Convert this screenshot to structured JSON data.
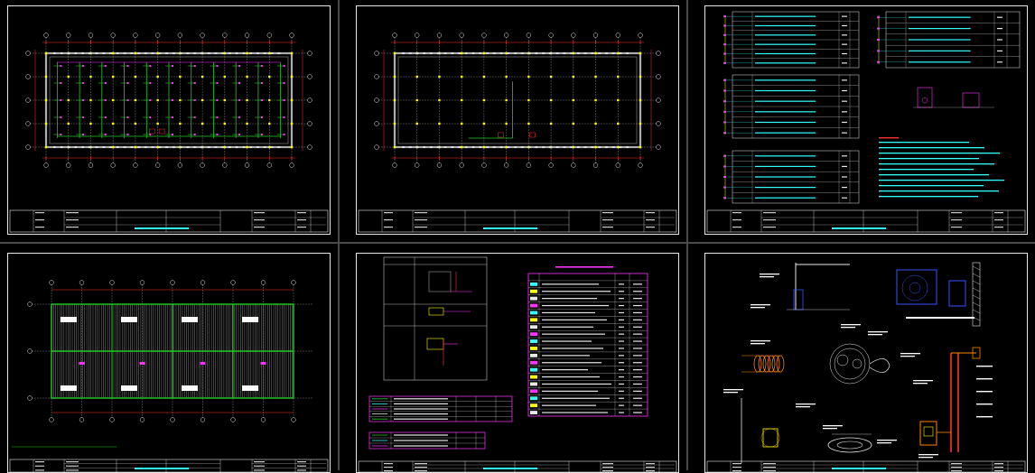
{
  "canvas": {
    "background": "#000000"
  },
  "colors": {
    "frame": "#e8e8e8",
    "axis": "#ff3030",
    "grid": "#9a9a9a",
    "wall": "#b0b0b0",
    "pipe_green": "#22cc22",
    "pipe_yellow": "#ffff00",
    "magenta": "#ff33ff",
    "cyan": "#33ffff",
    "blue": "#3355ff",
    "orange": "#ff8800"
  },
  "sheets": [
    {
      "id": 1,
      "type": "floor-plan-mep"
    },
    {
      "id": 2,
      "type": "floor-plan-structure"
    },
    {
      "id": 3,
      "type": "schedules-and-details"
    },
    {
      "id": 4,
      "type": "roof-plan"
    },
    {
      "id": 5,
      "type": "legend-and-equipment-list"
    },
    {
      "id": 6,
      "type": "installation-details"
    }
  ]
}
